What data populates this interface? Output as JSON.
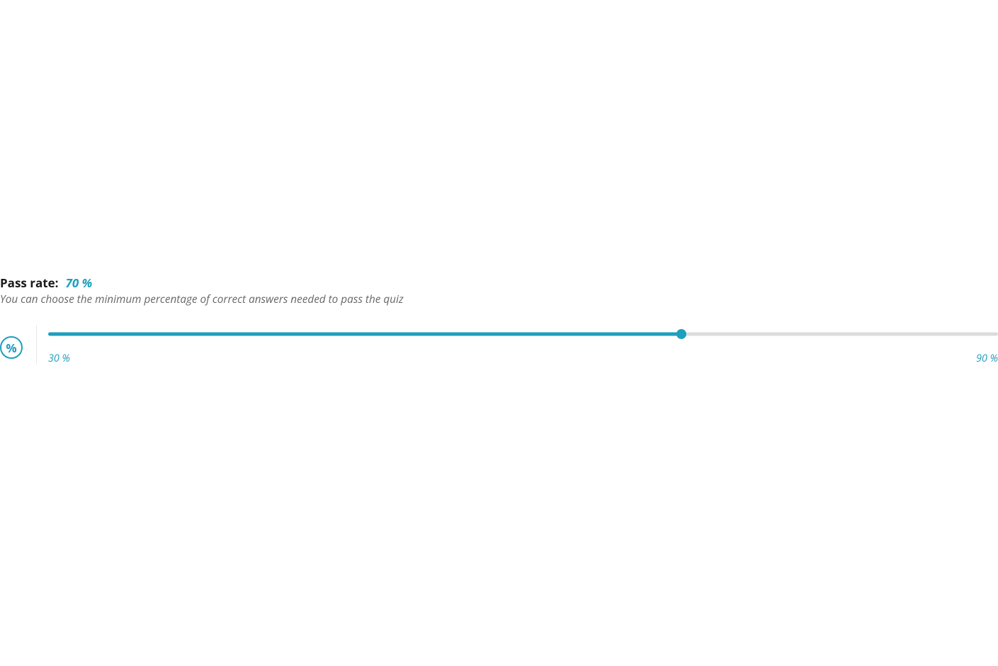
{
  "colors": {
    "accent": "#1d9fbf"
  },
  "passRate": {
    "label": "Pass rate:",
    "value": "70 %",
    "description": "You can choose the minimum percentage of correct answers needed to pass the quiz",
    "slider": {
      "minLabel": "30 %",
      "maxLabel": "90 %",
      "min": 30,
      "max": 90,
      "current": 70
    },
    "iconGlyph": "%"
  }
}
